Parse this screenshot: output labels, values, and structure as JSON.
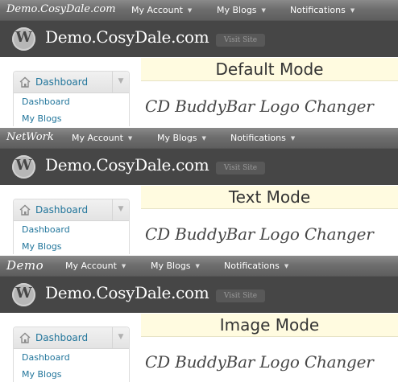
{
  "panels": [
    {
      "buddybar_logo": "Demo.CosyDale.com",
      "menu": [
        "My Account",
        "My Blogs",
        "Notifications"
      ],
      "site_title": "Demo.CosyDale.com",
      "visit_site": "Visit Site",
      "admin_menu": {
        "title": "Dashboard",
        "items": [
          "Dashboard",
          "My Blogs"
        ]
      },
      "mode_label": "Default Mode",
      "plugin_title": "CD BuddyBar Logo Changer"
    },
    {
      "buddybar_logo": "NetWork",
      "menu": [
        "My Account",
        "My Blogs",
        "Notifications"
      ],
      "site_title": "Demo.CosyDale.com",
      "visit_site": "Visit Site",
      "admin_menu": {
        "title": "Dashboard",
        "items": [
          "Dashboard",
          "My Blogs"
        ]
      },
      "mode_label": "Text Mode",
      "plugin_title": "CD BuddyBar Logo Changer"
    },
    {
      "buddybar_logo": "Demo",
      "menu": [
        "My Account",
        "My Blogs",
        "Notifications"
      ],
      "site_title": "Demo.CosyDale.com",
      "visit_site": "Visit Site",
      "admin_menu": {
        "title": "Dashboard",
        "items": [
          "Dashboard",
          "My Blogs"
        ]
      },
      "mode_label": "Image Mode",
      "plugin_title": "CD BuddyBar Logo Changer"
    }
  ],
  "icons": {
    "wordpress": "wordpress-logo-icon",
    "dashboard": "home-icon",
    "menu_toggle": "triangle-down-icon",
    "dropdown": "caret-down-icon"
  },
  "colors": {
    "buddybar": "#6e6e6e",
    "header": "#464646",
    "link": "#21759b",
    "mode_band": "#fffbe0"
  }
}
